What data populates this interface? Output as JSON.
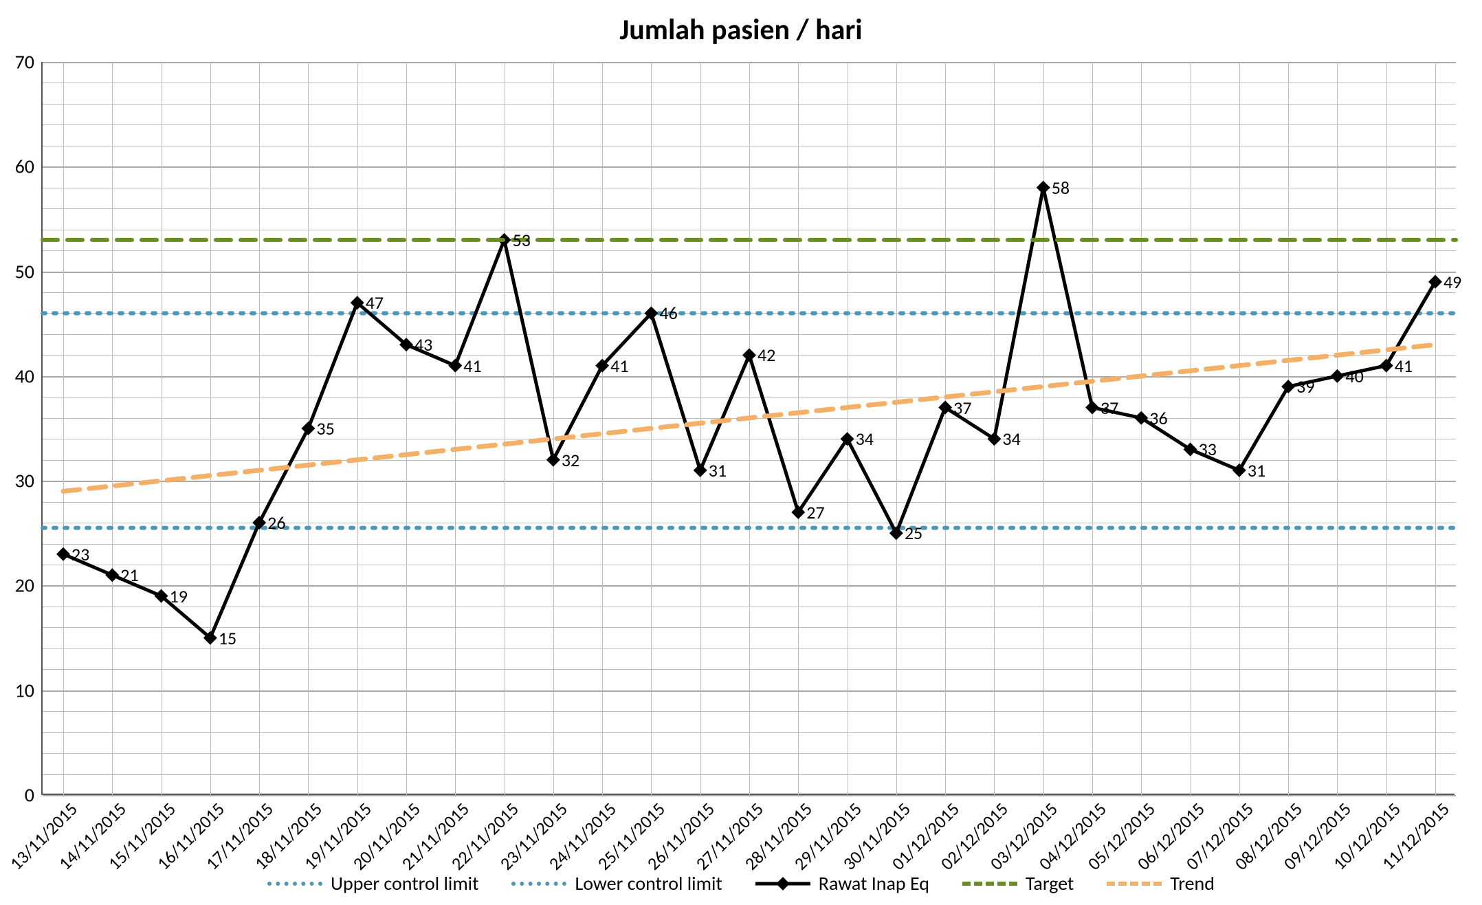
{
  "chart_data": {
    "type": "line",
    "title": "Jumlah pasien / hari",
    "xlabel": "",
    "ylabel": "",
    "ylim": [
      0,
      70
    ],
    "y_ticks": [
      0,
      10,
      20,
      30,
      40,
      50,
      60,
      70
    ],
    "categories": [
      "13/11/2015",
      "14/11/2015",
      "15/11/2015",
      "16/11/2015",
      "17/11/2015",
      "18/11/2015",
      "19/11/2015",
      "20/11/2015",
      "21/11/2015",
      "22/11/2015",
      "23/11/2015",
      "24/11/2015",
      "25/11/2015",
      "26/11/2015",
      "27/11/2015",
      "28/11/2015",
      "29/11/2015",
      "30/11/2015",
      "01/12/2015",
      "02/12/2015",
      "03/12/2015",
      "04/12/2015",
      "05/12/2015",
      "06/12/2015",
      "07/12/2015",
      "08/12/2015",
      "09/12/2015",
      "10/12/2015",
      "11/12/2015"
    ],
    "series": [
      {
        "name": "Upper control limit",
        "style": "dotted",
        "color": "#4f97b9",
        "constant": 46
      },
      {
        "name": "Lower control limit",
        "style": "dotted",
        "color": "#4f97b9",
        "constant": 25.5
      },
      {
        "name": "Rawat Inap Eq",
        "style": "solid-marker",
        "color": "#000000",
        "values": [
          23,
          21,
          19,
          15,
          26,
          35,
          47,
          43,
          41,
          53,
          32,
          41,
          46,
          31,
          42,
          27,
          34,
          25,
          37,
          34,
          58,
          37,
          36,
          33,
          31,
          39,
          40,
          41,
          49
        ]
      },
      {
        "name": "Target",
        "style": "dashed",
        "color": "#6b8e23",
        "constant": 53
      },
      {
        "name": "Trend",
        "style": "dashed",
        "color": "#f4b067",
        "linear": {
          "start": 29,
          "end": 43
        }
      }
    ],
    "legend_order": [
      "Upper control limit",
      "Lower control limit",
      "Rawat Inap Eq",
      "Target",
      "Trend"
    ]
  }
}
